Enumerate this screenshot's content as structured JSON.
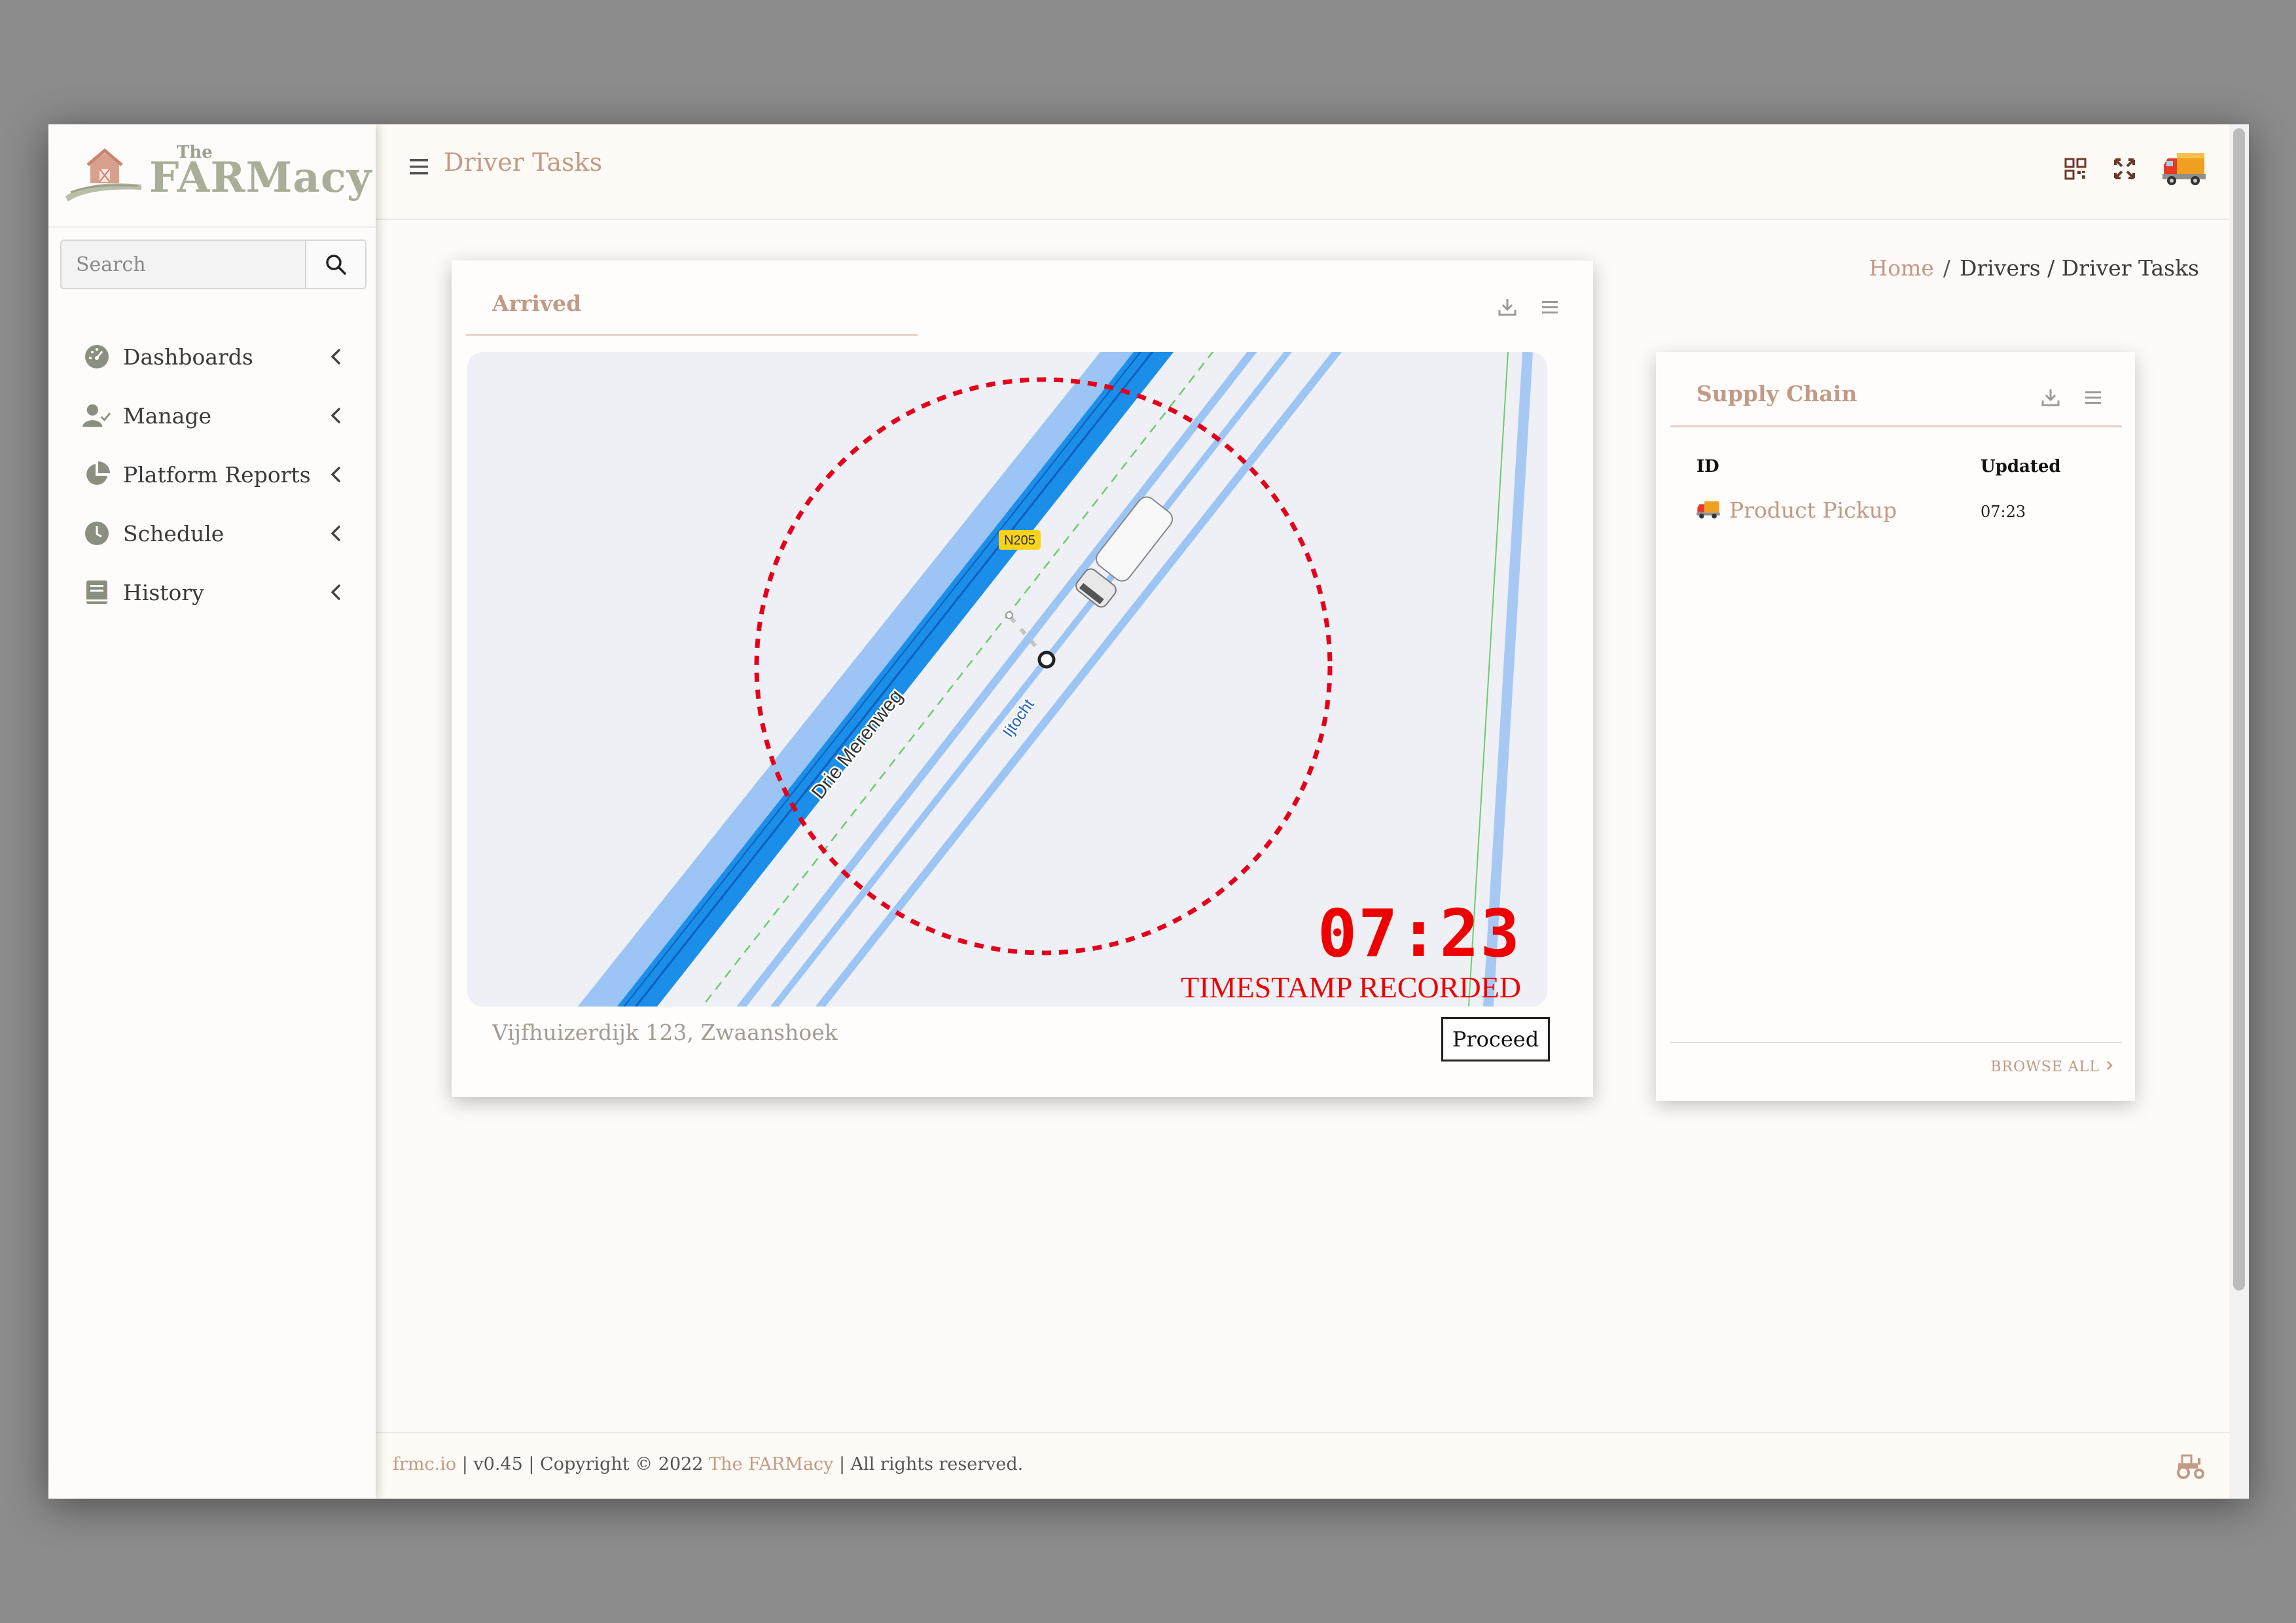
{
  "brand": {
    "the": "The",
    "name": "FARMacy"
  },
  "search": {
    "placeholder": "Search"
  },
  "sidebar": {
    "items": [
      {
        "label": "Dashboards",
        "icon": "dashboard-gauge-icon"
      },
      {
        "label": "Manage",
        "icon": "user-check-icon"
      },
      {
        "label": "Platform Reports",
        "icon": "pie-chart-icon"
      },
      {
        "label": "Schedule",
        "icon": "clock-icon"
      },
      {
        "label": "History",
        "icon": "book-icon"
      }
    ]
  },
  "topbar": {
    "title": "Driver Tasks",
    "icons": [
      "qr-code-icon",
      "fullscreen-icon",
      "delivery-truck-icon"
    ]
  },
  "breadcrumb": {
    "home": "Home",
    "sep": "/",
    "rest": "Drivers / Driver Tasks"
  },
  "arrived": {
    "title": "Arrived",
    "map": {
      "road_name": "Drie Merenweg",
      "route_badge": "N205",
      "path_name": "Ijtocht"
    },
    "timestamp": {
      "time": "07:23",
      "label": "TIMESTAMP RECORDED"
    },
    "address": "Vijfhuizerdijk 123, Zwaanshoek",
    "proceed_label": "Proceed"
  },
  "supply_chain": {
    "title": "Supply Chain",
    "columns": [
      "ID",
      "Updated"
    ],
    "rows": [
      {
        "id": "Product Pickup",
        "updated": "07:23",
        "icon": "delivery-truck-icon"
      }
    ],
    "browse_all": "BROWSE ALL"
  },
  "footer": {
    "site": "frmc.io",
    "version": "v0.45",
    "copyright": "Copyright © 2022",
    "company": "The FARMacy",
    "rights": "All rights reserved.",
    "sep": "|"
  },
  "colors": {
    "accent": "#c29a85",
    "timestamp": "#ee0000",
    "road_blue": "#1a8ee8"
  }
}
